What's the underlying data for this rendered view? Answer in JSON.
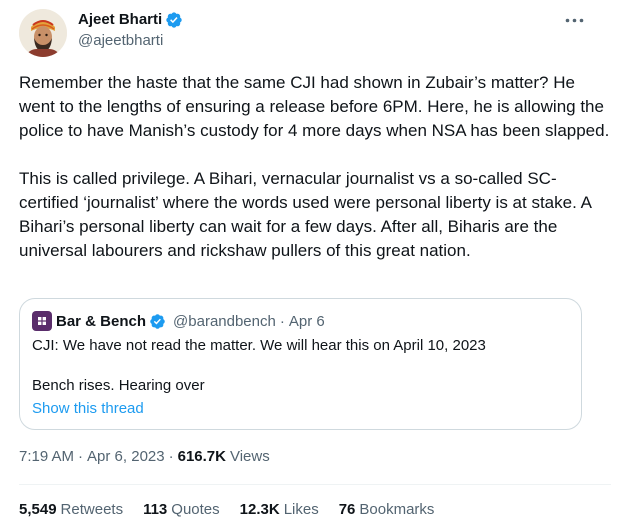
{
  "author": {
    "name": "Ajeet Bharti",
    "handle": "@ajeetbharti"
  },
  "tweet_text": {
    "p1": "Remember the haste that the same CJI had shown in Zubair’s matter? He went to the lengths of ensuring a release before 6PM. Here, he is allowing the police to have Manish’s custody for 4 more days when NSA has been slapped.",
    "p2": "This is called privilege. A Bihari, vernacular journalist vs a so-called SC-certified ‘journalist’ where the words used were personal liberty is at stake. A Bihari’s personal liberty can wait for a few days. After all, Biharis are the universal labourers and rickshaw pullers of this great nation."
  },
  "quote": {
    "name": "Bar & Bench",
    "handle": "@barandbench",
    "separator": "·",
    "date": "Apr 6",
    "line1": "CJI: We have not read the matter. We will hear this on April 10, 2023",
    "line2": "Bench rises. Hearing over",
    "show_thread": "Show this thread"
  },
  "meta": {
    "time": "7:19 AM",
    "sep": "·",
    "date": "Apr 6, 2023",
    "sep2": "·",
    "views_count": "616.7K",
    "views_label": "Views"
  },
  "stats": {
    "retweets_count": "5,549",
    "retweets_label": "Retweets",
    "quotes_count": "113",
    "quotes_label": "Quotes",
    "likes_count": "12.3K",
    "likes_label": "Likes",
    "bookmarks_count": "76",
    "bookmarks_label": "Bookmarks"
  },
  "colors": {
    "verified": "#1d9bf0",
    "link": "#1d9bf0",
    "secondary_text": "#536471",
    "border": "#cfd9de",
    "barbench_brand": "#5a2d6b"
  },
  "icons": {
    "verified": "verified-badge-icon",
    "more": "more-horizontal-icon",
    "quote_avatar": "bar-and-bench-logo"
  }
}
